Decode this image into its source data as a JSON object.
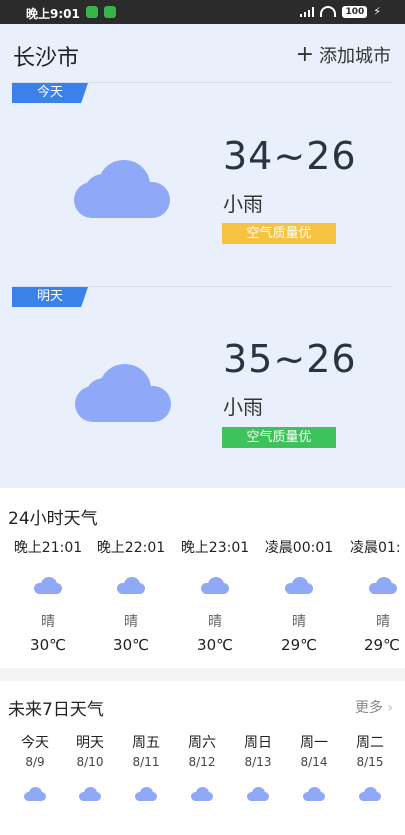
{
  "status_bar": {
    "time": "晚上9:01",
    "battery": "100"
  },
  "header": {
    "city": "长沙市",
    "add_city_label": "添加城市"
  },
  "today": {
    "tag": "今天",
    "temp_range": "34~26",
    "condition": "小雨",
    "air_quality": "空气质量优",
    "air_quality_color": "#f5c242",
    "icon": "cloud-icon"
  },
  "tomorrow": {
    "tag": "明天",
    "temp_range": "35~26",
    "condition": "小雨",
    "air_quality": "空气质量优",
    "air_quality_color": "#3ec25b",
    "icon": "cloud-icon"
  },
  "hourly": {
    "title": "24小时天气",
    "items": [
      {
        "time": "晚上21:01",
        "condition": "晴",
        "temp": "30℃"
      },
      {
        "time": "晚上22:01",
        "condition": "晴",
        "temp": "30℃"
      },
      {
        "time": "晚上23:01",
        "condition": "晴",
        "temp": "30℃"
      },
      {
        "time": "凌晨00:01",
        "condition": "晴",
        "temp": "29℃"
      },
      {
        "time": "凌晨01:",
        "condition": "晴",
        "temp": "29℃"
      }
    ]
  },
  "weekly": {
    "title": "未来7日天气",
    "more_label": "更多",
    "days": [
      {
        "name": "今天",
        "date": "8/9"
      },
      {
        "name": "明天",
        "date": "8/10"
      },
      {
        "name": "周五",
        "date": "8/11"
      },
      {
        "name": "周六",
        "date": "8/12"
      },
      {
        "name": "周日",
        "date": "8/13"
      },
      {
        "name": "周一",
        "date": "8/14"
      },
      {
        "name": "周二",
        "date": "8/15"
      }
    ]
  },
  "colors": {
    "accent": "#3a82ea",
    "cloud": "#8fa9f8"
  }
}
